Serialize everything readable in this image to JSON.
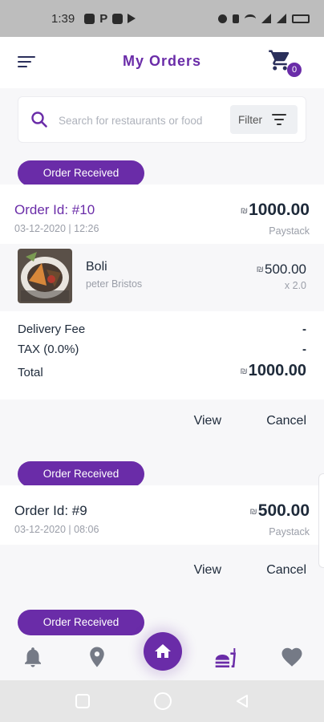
{
  "status_bar": {
    "time": "1:39"
  },
  "header": {
    "title": "My Orders",
    "cart_count": "0"
  },
  "search": {
    "placeholder": "Search for restaurants or food",
    "filter_label": "Filter"
  },
  "orders": [
    {
      "status": "Order Received",
      "order_id": "Order Id: #10",
      "date": "03-12-2020 | 12:26",
      "total": "1000.00",
      "payment": "Paystack",
      "items": [
        {
          "name": "Boli",
          "seller": "peter Bristos",
          "price": "500.00",
          "qty": "x 2.0"
        }
      ],
      "summary": {
        "delivery_label": "Delivery Fee",
        "delivery_value": "-",
        "tax_label": "TAX (0.0%)",
        "tax_value": "-",
        "total_label": "Total",
        "total_value": "1000.00"
      },
      "view_label": "View",
      "cancel_label": "Cancel"
    },
    {
      "status": "Order Received",
      "order_id": "Order Id: #9",
      "date": "03-12-2020 | 08:06",
      "total": "500.00",
      "payment": "Paystack",
      "view_label": "View",
      "cancel_label": "Cancel"
    },
    {
      "status": "Order Received"
    }
  ],
  "colors": {
    "accent": "#6a2ca8",
    "dark_text": "#1e2a3a",
    "muted_text": "#9a9ea8"
  },
  "bottom_nav": {
    "icons": [
      "bell-icon",
      "location-pin-icon",
      "home-icon",
      "food-icon",
      "heart-icon"
    ]
  }
}
